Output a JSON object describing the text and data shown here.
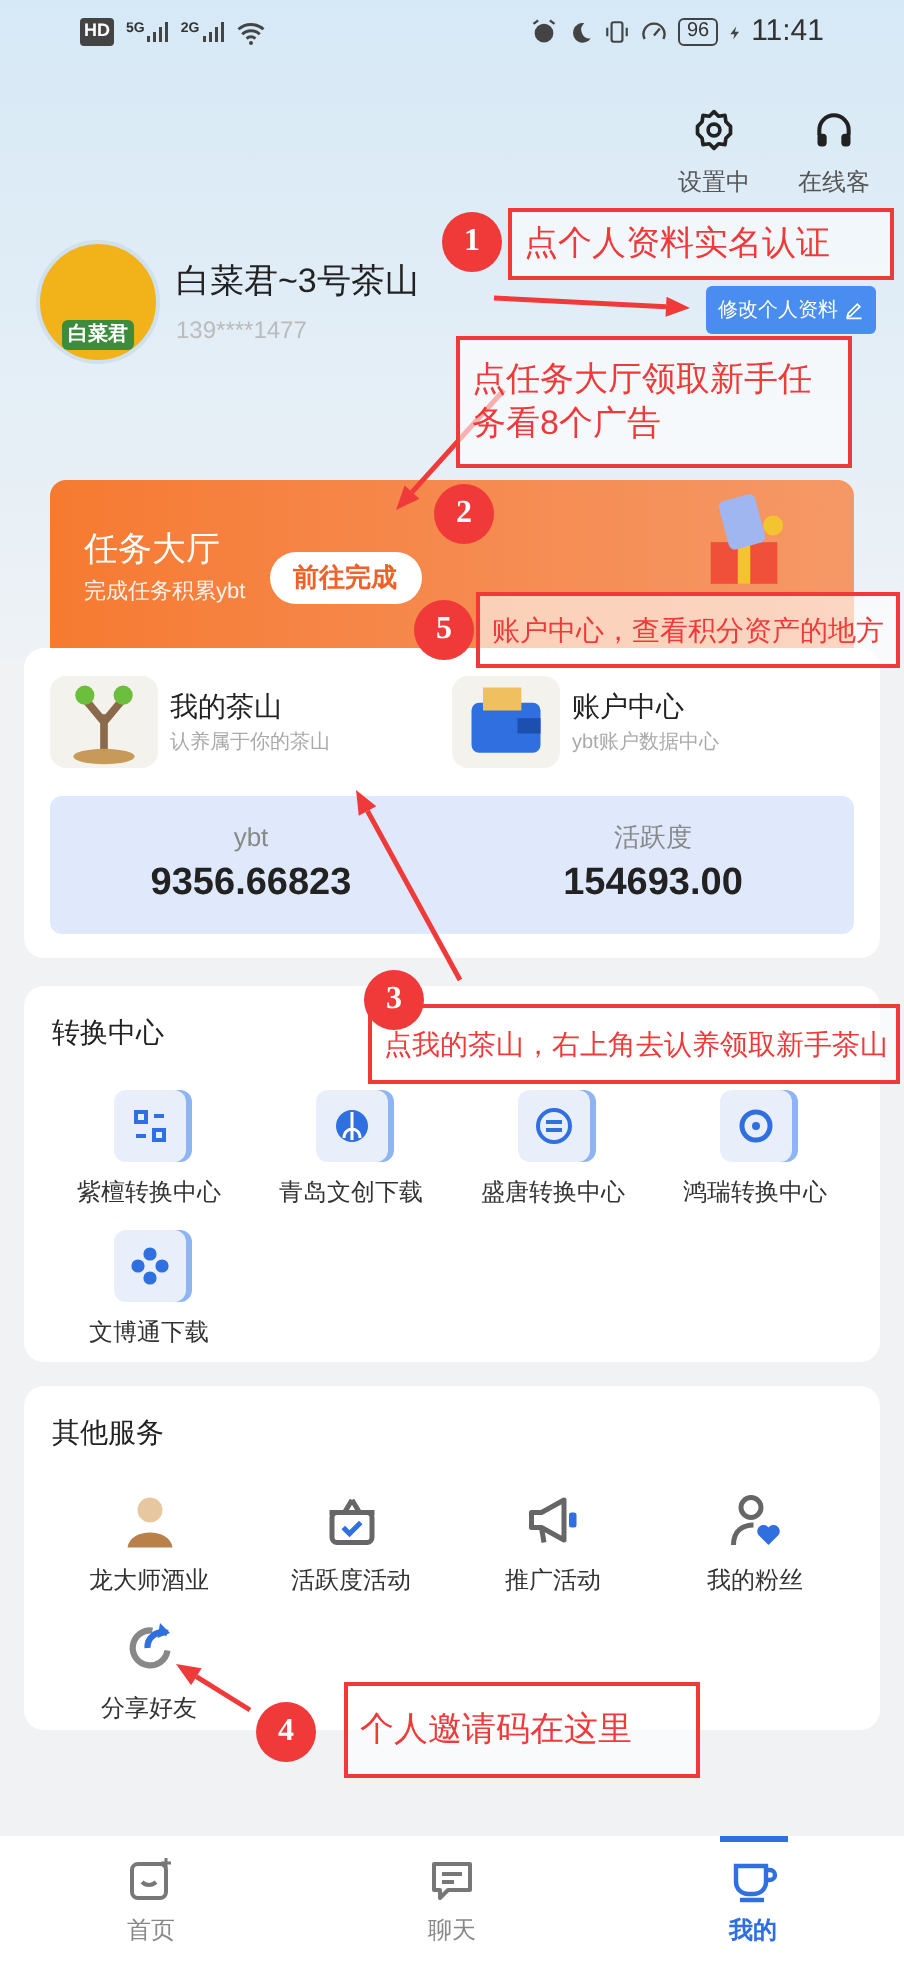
{
  "status_bar": {
    "hd": "HD",
    "networks": [
      "5G",
      "2G"
    ],
    "battery": "96",
    "time": "11:41"
  },
  "top_actions": [
    {
      "kind": "settings",
      "label": "设置中"
    },
    {
      "kind": "headset",
      "label": "在线客"
    }
  ],
  "profile": {
    "avatar_label": "白菜君",
    "name": "白菜君~3号茶山",
    "phone": "139****1477",
    "edit_button": "修改个人资料"
  },
  "task_banner": {
    "title": "任务大厅",
    "subtitle": "完成任务积累ybt",
    "button": "前往完成"
  },
  "shortcuts": [
    {
      "kind": "tree",
      "title": "我的茶山",
      "subtitle": "认养属于你的茶山"
    },
    {
      "kind": "wallet",
      "title": "账户中心",
      "subtitle": "ybt账户数据中心"
    }
  ],
  "stats": [
    {
      "label": "ybt",
      "value": "9356.66823"
    },
    {
      "label": "活跃度",
      "value": "154693.00"
    }
  ],
  "convert_center": {
    "title": "转换中心",
    "items": [
      {
        "kind": "swap",
        "label": "紫檀转换中心"
      },
      {
        "kind": "globe",
        "label": "青岛文创下载"
      },
      {
        "kind": "list",
        "label": "盛唐转换中心"
      },
      {
        "kind": "ring",
        "label": "鸿瑞转换中心"
      },
      {
        "kind": "clover",
        "label": "文博通下载"
      }
    ]
  },
  "other_services": {
    "title": "其他服务",
    "items": [
      {
        "kind": "portrait",
        "label": "龙大师酒业"
      },
      {
        "kind": "gift",
        "label": "活跃度活动"
      },
      {
        "kind": "megaphone",
        "label": "推广活动"
      },
      {
        "kind": "fans",
        "label": "我的粉丝"
      },
      {
        "kind": "share",
        "label": "分享好友"
      }
    ]
  },
  "bottom_nav": [
    {
      "kind": "home",
      "label": "首页",
      "selected": false
    },
    {
      "kind": "chat",
      "label": "聊天",
      "selected": false
    },
    {
      "kind": "cup",
      "label": "我的",
      "selected": true
    }
  ],
  "annotations": [
    {
      "number": "1",
      "text": "点个人资料实名认证"
    },
    {
      "number": "2",
      "text": "点任务大厅领取新手任务看8个广告"
    },
    {
      "number": "5",
      "text": "账户中心，查看积分资产的地方"
    },
    {
      "number": "3",
      "text": "点我的茶山，右上角去认养领取新手茶山"
    },
    {
      "number": "4",
      "text": "个人邀请码在这里"
    }
  ]
}
